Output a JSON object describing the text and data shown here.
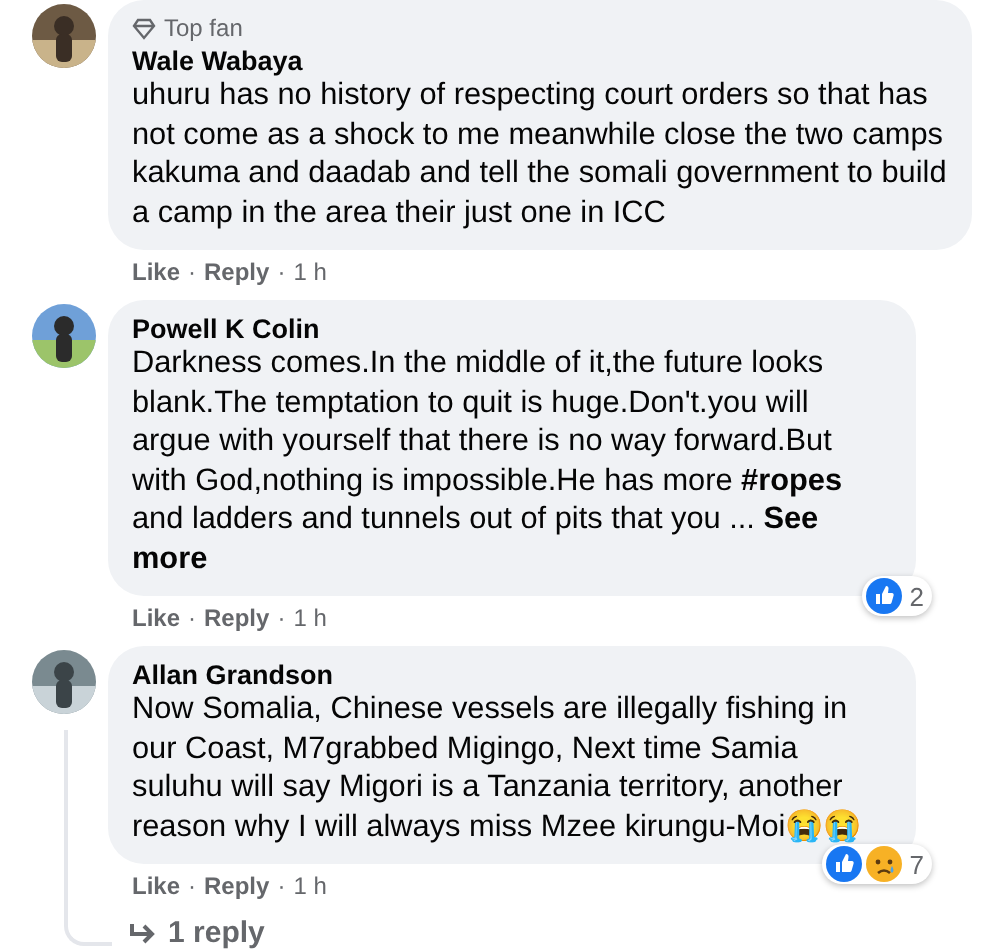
{
  "comments": [
    {
      "author": "Wale Wabaya",
      "badge": "Top fan",
      "text": "uhuru has no history of respecting court orders so that has not come as a shock to me meanwhile close the two camps kakuma and daadab and tell the somali government to build a camp in the area their just one in ICC",
      "footer": [
        {
          "kind": "link",
          "text": "Like"
        },
        {
          "kind": "sep",
          "text": "·"
        },
        {
          "kind": "link",
          "text": "Reply"
        },
        {
          "kind": "sep",
          "text": "·"
        },
        {
          "kind": "time",
          "text": "1 h"
        }
      ]
    },
    {
      "author": "Powell K Colin",
      "text": "Darkness comes.In the middle of it,the future looks blank.The temptation to quit is huge.Don't.you will argue with yourself that there is no way forward.But with God,nothing is impossible.He has more **#ropes** and ladders and tunnels out of pits that you ... **See more**",
      "reactions": {
        "like": true,
        "sad": false,
        "count": "2"
      },
      "footer": [
        {
          "kind": "link",
          "text": "Like"
        },
        {
          "kind": "sep",
          "text": "·"
        },
        {
          "kind": "link",
          "text": "Reply"
        },
        {
          "kind": "sep",
          "text": "·"
        },
        {
          "kind": "time",
          "text": "1 h"
        }
      ]
    },
    {
      "author": "Allan Grandson",
      "text": "Now Somalia, Chinese vessels are illegally fishing in our Coast, M7grabbed Migingo, Next time Samia suluhu will say Migori is a Tanzania territory, another reason why I will always miss Mzee kirungu-Moi😭😭",
      "reactions": {
        "like": true,
        "sad": true,
        "count": "7"
      },
      "footer": [
        {
          "kind": "link",
          "text": "Like"
        },
        {
          "kind": "sep",
          "text": "·"
        },
        {
          "kind": "link",
          "text": "Reply"
        },
        {
          "kind": "sep",
          "text": "·"
        },
        {
          "kind": "time",
          "text": "1 h"
        }
      ],
      "replies": "1 reply"
    }
  ]
}
